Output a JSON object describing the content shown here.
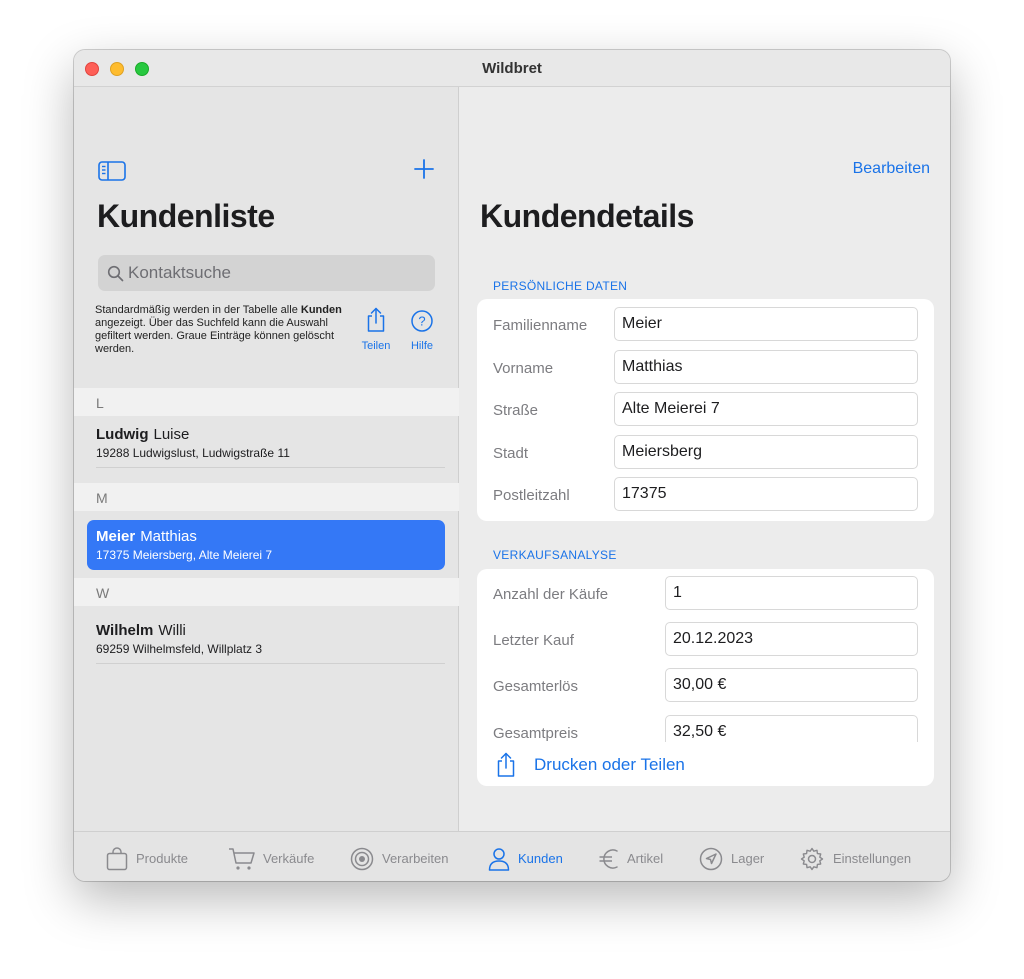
{
  "window": {
    "title": "Wildbret"
  },
  "sidebar": {
    "title": "Kundenliste",
    "search_placeholder": "Kontaktsuche",
    "hint": {
      "part1": "Standardmäßig werden in der Tabelle alle ",
      "bold": "Kunden",
      "part2": " angezeigt. Über das Suchfeld kann die Auswahl gefiltert werden. Graue Einträge können gelöscht werden."
    },
    "share_label": "Teilen",
    "help_label": "Hilfe",
    "sections": [
      {
        "letter": "L",
        "rows": [
          {
            "last": "Ludwig",
            "first": "Luise",
            "address": "19288 Ludwigslust, Ludwigstraße 11"
          }
        ]
      },
      {
        "letter": "M",
        "rows": [
          {
            "last": "Meier",
            "first": "Matthias",
            "address": "17375 Meiersberg, Alte Meierei 7"
          }
        ]
      },
      {
        "letter": "W",
        "rows": [
          {
            "last": "Wilhelm",
            "first": "Willi",
            "address": "69259 Wilhelmsfeld, Willplatz 3"
          }
        ]
      }
    ]
  },
  "detail": {
    "edit_label": "Bearbeiten",
    "title": "Kundendetails",
    "personal": {
      "header": "PERSÖNLICHE DATEN",
      "fields": [
        {
          "label": "Familienname",
          "value": "Meier"
        },
        {
          "label": "Vorname",
          "value": "Matthias"
        },
        {
          "label": "Straße",
          "value": "Alte Meierei 7"
        },
        {
          "label": "Stadt",
          "value": "Meiersberg"
        },
        {
          "label": "Postleitzahl",
          "value": "17375"
        }
      ]
    },
    "sales": {
      "header": "VERKAUFSANALYSE",
      "fields": [
        {
          "label": "Anzahl der Käufe",
          "value": "1"
        },
        {
          "label": "Letzter Kauf",
          "value": "20.12.2023"
        },
        {
          "label": "Gesamterlös",
          "value": "30,00 €"
        },
        {
          "label": "Gesamtpreis",
          "value": "32,50 €"
        }
      ]
    },
    "share_button": "Drucken oder Teilen"
  },
  "tabs": [
    {
      "label": "Produkte",
      "icon": "bag-icon",
      "active": false
    },
    {
      "label": "Verkäufe",
      "icon": "cart-icon",
      "active": false
    },
    {
      "label": "Verarbeiten",
      "icon": "target-icon",
      "active": false
    },
    {
      "label": "Kunden",
      "icon": "person-icon",
      "active": true
    },
    {
      "label": "Artikel",
      "icon": "euro-icon",
      "active": false
    },
    {
      "label": "Lager",
      "icon": "location-icon",
      "active": false
    },
    {
      "label": "Einstellungen",
      "icon": "gear-icon",
      "active": false
    }
  ],
  "colors": {
    "accent": "#1a73e8",
    "selection": "#3478f6"
  }
}
